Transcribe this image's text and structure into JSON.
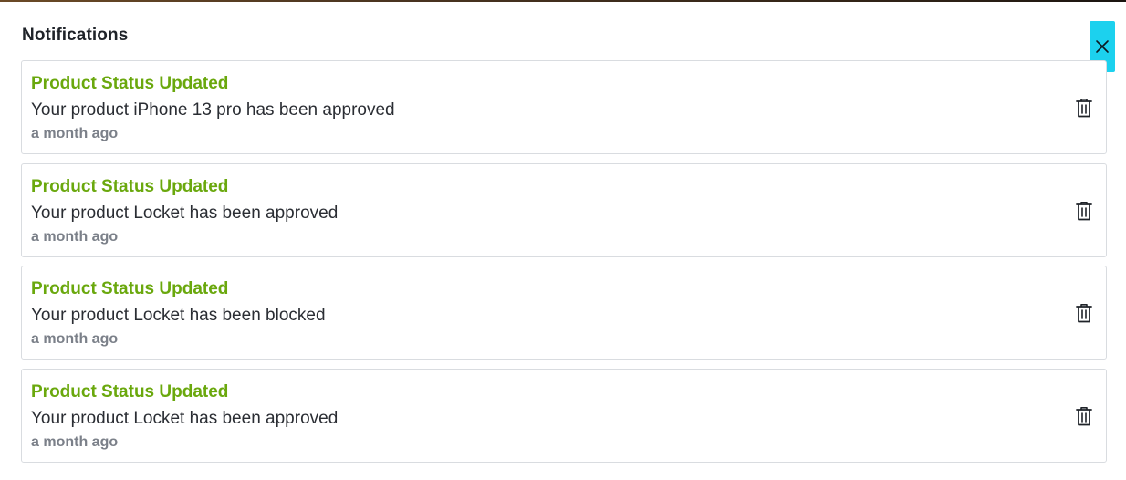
{
  "header": {
    "title": "Notifications",
    "close_icon": "close-icon"
  },
  "colors": {
    "accent_close_button": "#1cd1ee",
    "title_green": "#6aa80d",
    "time_gray": "#7b8089",
    "card_border": "#d9dce0"
  },
  "notifications": [
    {
      "title": "Product Status Updated",
      "message": "Your product iPhone 13 pro has been approved",
      "time": "a month ago",
      "action_icon": "trash-icon"
    },
    {
      "title": "Product Status Updated",
      "message": "Your product Locket has been approved",
      "time": "a month ago",
      "action_icon": "trash-icon"
    },
    {
      "title": "Product Status Updated",
      "message": "Your product Locket has been blocked",
      "time": "a month ago",
      "action_icon": "trash-icon"
    },
    {
      "title": "Product Status Updated",
      "message": "Your product Locket has been approved",
      "time": "a month ago",
      "action_icon": "trash-icon"
    }
  ]
}
